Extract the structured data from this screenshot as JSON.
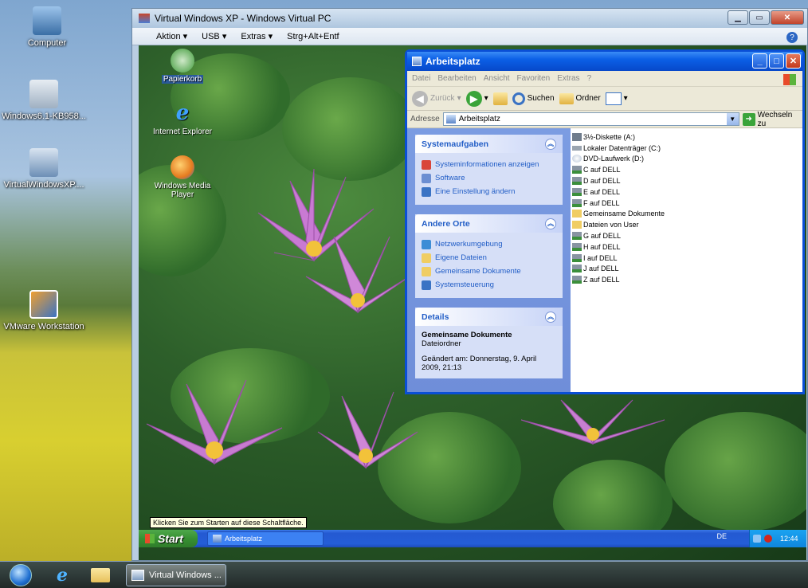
{
  "host_desktop": {
    "icons": [
      {
        "name": "Computer",
        "icon": "computer-icon"
      },
      {
        "name": "Windows6.1-KB958...",
        "icon": "installer-icon"
      },
      {
        "name": "VirtualWindowsXP....",
        "icon": "vpc-installer-icon"
      },
      {
        "name": "VMware Workstation",
        "icon": "vmware-icon"
      }
    ]
  },
  "host_taskbar": {
    "task_label": "Virtual Windows ..."
  },
  "vpc_window": {
    "title": "Virtual Windows XP - Windows Virtual PC",
    "menu": [
      "Aktion ▾",
      "USB ▾",
      "Extras ▾",
      "Strg+Alt+Entf"
    ],
    "help_icon": "help-icon"
  },
  "guest_desktop": {
    "icons": [
      {
        "name": "Papierkorb",
        "icon": "recycle-bin-icon"
      },
      {
        "name": "Internet Explorer",
        "icon": "ie-icon"
      },
      {
        "name": "Windows Media Player",
        "icon": "wmp-icon"
      }
    ]
  },
  "explorer": {
    "title": "Arbeitsplatz",
    "menu": [
      "Datei",
      "Bearbeiten",
      "Ansicht",
      "Favoriten",
      "Extras",
      "?"
    ],
    "toolbar": {
      "back": "Zurück",
      "search": "Suchen",
      "folders": "Ordner"
    },
    "address_label": "Adresse",
    "address_value": "Arbeitsplatz",
    "go_label": "Wechseln zu",
    "taskpane": {
      "system": {
        "title": "Systemaufgaben",
        "items": [
          "Systeminformationen anzeigen",
          "Software",
          "Eine Einstellung ändern"
        ]
      },
      "other": {
        "title": "Andere Orte",
        "items": [
          "Netzwerkumgebung",
          "Eigene Dateien",
          "Gemeinsame Dokumente",
          "Systemsteuerung"
        ]
      },
      "details": {
        "title": "Details",
        "name": "Gemeinsame Dokumente",
        "type": "Dateiordner",
        "modified": "Geändert am: Donnerstag, 9. April 2009, 21:13"
      }
    },
    "files": [
      {
        "name": "3½-Diskette (A:)",
        "kind": "floppy"
      },
      {
        "name": "Lokaler Datenträger (C:)",
        "kind": "disk"
      },
      {
        "name": "DVD-Laufwerk (D:)",
        "kind": "dvd"
      },
      {
        "name": "C auf DELL",
        "kind": "netdrive"
      },
      {
        "name": "D auf DELL",
        "kind": "netdrive"
      },
      {
        "name": "E auf DELL",
        "kind": "netdrive"
      },
      {
        "name": "F auf DELL",
        "kind": "netdrive"
      },
      {
        "name": "Gemeinsame Dokumente",
        "kind": "folder"
      },
      {
        "name": "Dateien von User",
        "kind": "folder"
      },
      {
        "name": "G auf DELL",
        "kind": "netdrive"
      },
      {
        "name": "H auf DELL",
        "kind": "netdrive"
      },
      {
        "name": "I auf DELL",
        "kind": "netdrive"
      },
      {
        "name": "J auf DELL",
        "kind": "netdrive"
      },
      {
        "name": "Z auf DELL",
        "kind": "netdrive"
      }
    ]
  },
  "guest_taskbar": {
    "tooltip": "Klicken Sie zum Starten auf diese Schaltfläche.",
    "start": "Start",
    "task": "Arbeitsplatz",
    "lang": "DE",
    "clock": "12:44"
  }
}
